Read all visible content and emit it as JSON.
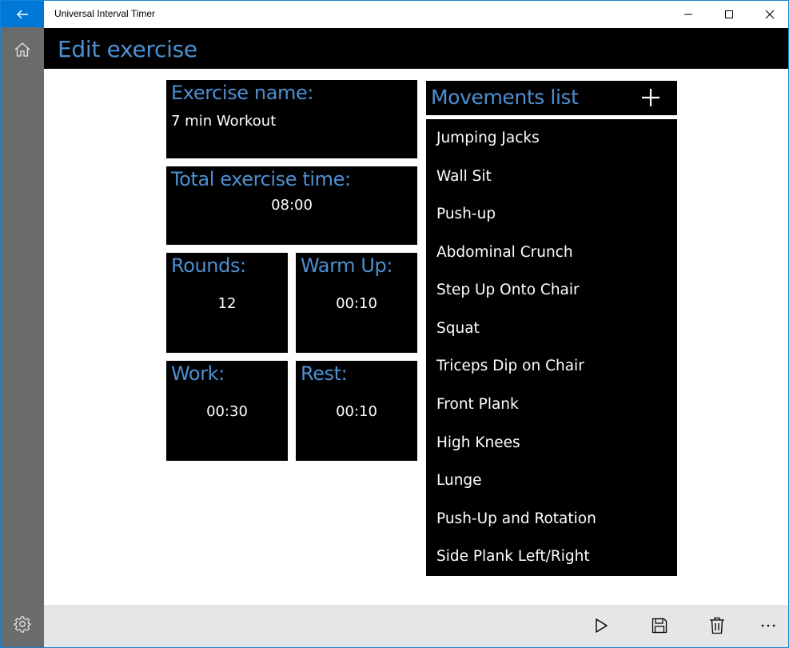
{
  "window": {
    "title": "Universal Interval Timer",
    "accent": "#0078d7"
  },
  "nav": {
    "home_icon": "home-icon",
    "settings_icon": "gear-icon"
  },
  "page": {
    "title": "Edit exercise",
    "title_color": "#4d8fd1"
  },
  "exercise": {
    "name_label": "Exercise name:",
    "name_value": "7 min Workout",
    "total_label": "Total exercise time:",
    "total_value": "08:00",
    "rounds_label": "Rounds:",
    "rounds_value": "12",
    "warmup_label": "Warm Up:",
    "warmup_value": "00:10",
    "work_label": "Work:",
    "work_value": "00:30",
    "rest_label": "Rest:",
    "rest_value": "00:10"
  },
  "movements": {
    "title": "Movements list",
    "add_icon": "plus-icon",
    "items": [
      "Jumping Jacks",
      "Wall Sit",
      "Push-up",
      "Abdominal Crunch",
      "Step Up Onto Chair",
      "Squat",
      "Triceps Dip on Chair",
      "Front Plank",
      "High Knees",
      "Lunge",
      "Push-Up and Rotation",
      "Side Plank Left/Right"
    ]
  },
  "command_bar": {
    "icons": [
      "play-icon",
      "save-icon",
      "delete-icon",
      "more-icon"
    ]
  }
}
